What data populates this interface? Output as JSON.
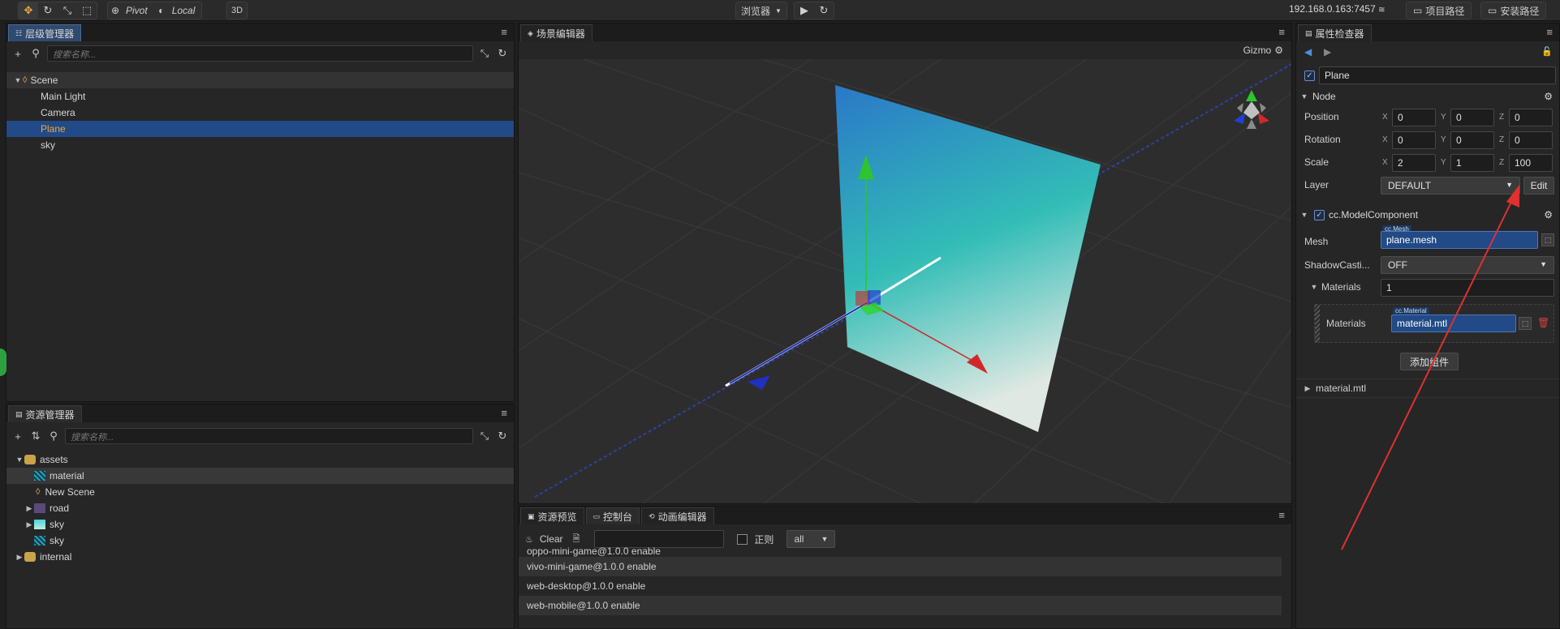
{
  "toolbar": {
    "pivot": "Pivot",
    "local": "Local",
    "mode_3d": "3D",
    "preview": "浏览器",
    "ip": "192.168.0.163:7457",
    "project_path": "项目路径",
    "install_path": "安装路径"
  },
  "hierarchy": {
    "title": "层级管理器",
    "search_placeholder": "搜索名称...",
    "root": "Scene",
    "items": [
      "Main Light",
      "Camera",
      "Plane",
      "sky"
    ],
    "selected": "Plane"
  },
  "assets": {
    "title": "资源管理器",
    "search_placeholder": "搜索名称...",
    "items": [
      {
        "label": "assets",
        "depth": 0,
        "expanded": true
      },
      {
        "label": "material",
        "depth": 1,
        "expanded": null
      },
      {
        "label": "New Scene",
        "depth": 1,
        "expanded": null
      },
      {
        "label": "road",
        "depth": 1,
        "expanded": false
      },
      {
        "label": "sky",
        "depth": 1,
        "expanded": false
      },
      {
        "label": "sky",
        "depth": 1,
        "expanded": null
      },
      {
        "label": "internal",
        "depth": 0,
        "expanded": false
      }
    ]
  },
  "scene": {
    "title": "场景编辑器",
    "gizmo": "Gizmo"
  },
  "console": {
    "tabs": [
      "资源预览",
      "控制台",
      "动画编辑器"
    ],
    "clear": "Clear",
    "regex": "正则",
    "filter": "all",
    "lines": [
      "oppo-mini-game@1.0.0 enable",
      "vivo-mini-game@1.0.0 enable",
      "web-desktop@1.0.0 enable",
      "web-mobile@1.0.0 enable"
    ]
  },
  "inspector": {
    "title": "属性检查器",
    "node_name": "Plane",
    "node_section": "Node",
    "position_label": "Position",
    "rotation_label": "Rotation",
    "scale_label": "Scale",
    "layer_label": "Layer",
    "axis_x": "X",
    "axis_y": "Y",
    "axis_z": "Z",
    "position": {
      "x": "0",
      "y": "0",
      "z": "0"
    },
    "rotation": {
      "x": "0",
      "y": "0",
      "z": "0"
    },
    "scale": {
      "x": "2",
      "y": "1",
      "z": "100"
    },
    "layer": "DEFAULT",
    "edit": "Edit",
    "component": "cc.ModelComponent",
    "mesh_label": "Mesh",
    "mesh_type": "cc.Mesh",
    "mesh_value": "plane.mesh",
    "shadow_label": "ShadowCasti...",
    "shadow_value": "OFF",
    "materials_label": "Materials",
    "materials_count": "1",
    "material_item_label": "Materials",
    "material_type": "cc.Material",
    "material_value": "material.mtl",
    "add_component": "添加组件",
    "asset_footer": "material.mtl"
  },
  "colors": {
    "selection": "#214a86",
    "accent_orange": "#e8a84a",
    "annotation_red": "#e03030"
  }
}
